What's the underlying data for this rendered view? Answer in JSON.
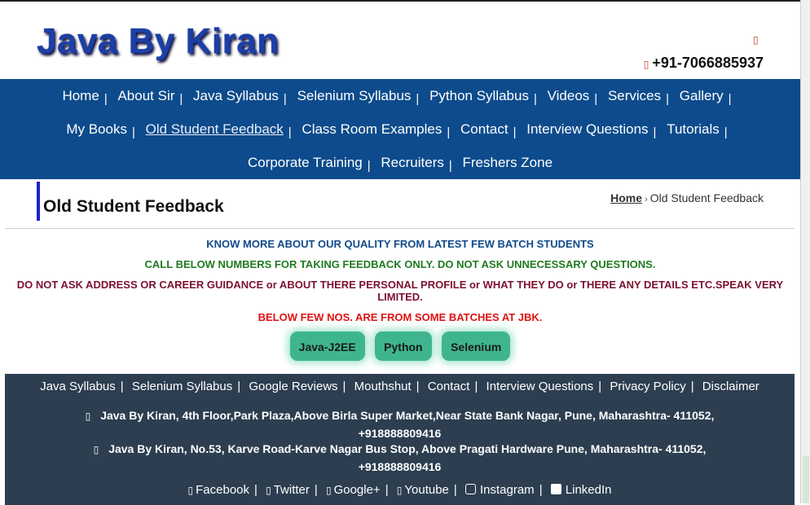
{
  "header": {
    "logo": "Java By Kiran",
    "phone_icon": "",
    "phone": "+91-7066885937"
  },
  "nav": {
    "row1": [
      "Home",
      "About Sir",
      "Java Syllabus",
      "Selenium Syllabus",
      "Python Syllabus",
      "Videos",
      "Services",
      "Gallery"
    ],
    "row2": [
      "My Books",
      "Old Student Feedback",
      "Class Room Examples",
      "Contact",
      "Interview Questions",
      "Tutorials"
    ],
    "row3": [
      "Corporate Training",
      "Recruiters",
      "Freshers Zone"
    ],
    "separator": "|",
    "active": "Old Student Feedback"
  },
  "page": {
    "title": "Old Student Feedback",
    "breadcrumb_home": "Home",
    "breadcrumb_sep": "›",
    "breadcrumb_current": "Old Student Feedback"
  },
  "notices": {
    "n1": "KNOW MORE ABOUT OUR QUALITY FROM LATEST FEW BATCH STUDENTS",
    "n2": "CALL BELOW NUMBERS FOR TAKING FEEDBACK ONLY. DO NOT ASK UNNECESSARY QUESTIONS.",
    "n3": "DO NOT ASK ADDRESS OR CAREER GUIDANCE or ABOUT THERE PERSONAL PROFILE or WHAT THEY DO or THERE ANY DETAILS ETC.SPEAK VERY LIMITED.",
    "n4": "BELOW FEW NOS. ARE FROM SOME BATCHES AT JBK."
  },
  "buttons": [
    "Java-J2EE",
    "Python",
    "Selenium"
  ],
  "footer": {
    "links": [
      "Java Syllabus",
      "Selenium Syllabus",
      "Google Reviews",
      "Mouthshut",
      "Contact",
      "Interview Questions",
      "Privacy Policy",
      "Disclaimer"
    ],
    "address_icon": "",
    "address1": "Java By Kiran, 4th Floor,Park Plaza,Above Birla Super Market,Near State Bank Nagar, Pune, Maharashtra- 411052,",
    "phone1": "+918888809416",
    "address2": "Java By Kiran, No.53, Karve Road-Karve Nagar Bus Stop, Above Pragati Hardware Pune, Maharashtra- 411052,",
    "phone2": "+918888809416",
    "social": [
      {
        "label": "Facebook",
        "icon": "facebook-icon"
      },
      {
        "label": "Twitter",
        "icon": "twitter-icon"
      },
      {
        "label": "Google+",
        "icon": "google-plus-icon"
      },
      {
        "label": "Youtube",
        "icon": "youtube-icon"
      },
      {
        "label": "Instagram",
        "icon": "instagram-icon"
      },
      {
        "label": "LinkedIn",
        "icon": "linkedin-icon"
      }
    ]
  },
  "colors": {
    "nav_bg": "#0d4b8c",
    "footer_bg": "#2c3e50",
    "button_bg": "#3fb58f",
    "logo": "#1b3fa6"
  }
}
